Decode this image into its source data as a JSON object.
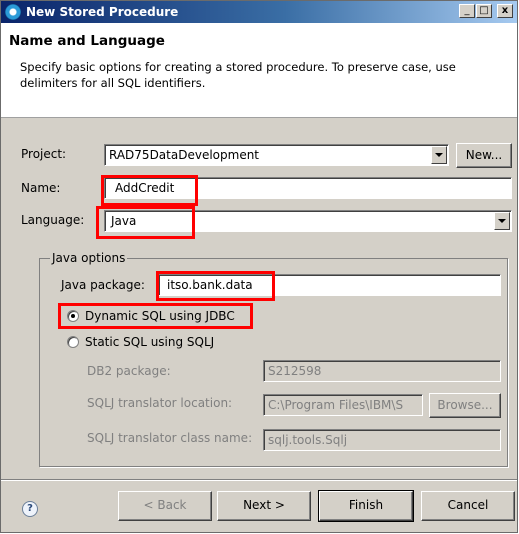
{
  "window": {
    "title": "New Stored Procedure",
    "minimize_glyph": "_",
    "maximize_glyph": "□",
    "close_glyph": "x"
  },
  "header": {
    "title": "Name and Language",
    "description": "Specify basic options for creating a stored procedure. To preserve case, use delimiters for all SQL identifiers."
  },
  "form": {
    "project_label": "Project:",
    "project_value": "RAD75DataDevelopment",
    "new_button": "New...",
    "name_label": "Name:",
    "name_value": "AddCredit",
    "language_label": "Language:",
    "language_value": "Java"
  },
  "java_options": {
    "group_label": "Java options",
    "package_label": "Java package:",
    "package_value": "itso.bank.data",
    "dynamic_sql_label": "Dynamic SQL using JDBC",
    "static_sql_label": "Static SQL using SQLJ",
    "selected": "dynamic",
    "db2_package_label": "DB2 package:",
    "db2_package_value": "S212598",
    "translator_location_label": "SQLJ translator location:",
    "translator_location_value": "C:\\Program Files\\IBM\\S",
    "browse_button": "Browse...",
    "translator_class_label": "SQLJ translator class name:",
    "translator_class_value": "sqlj.tools.Sqlj"
  },
  "footer": {
    "help_glyph": "?",
    "back_button": "< Back",
    "next_button": "Next >",
    "finish_button": "Finish",
    "cancel_button": "Cancel"
  },
  "colors": {
    "highlight": "#ff0000",
    "titlebar_start": "#0a246a",
    "titlebar_end": "#a6caf0",
    "dialog_bg": "#d4d0c8"
  }
}
